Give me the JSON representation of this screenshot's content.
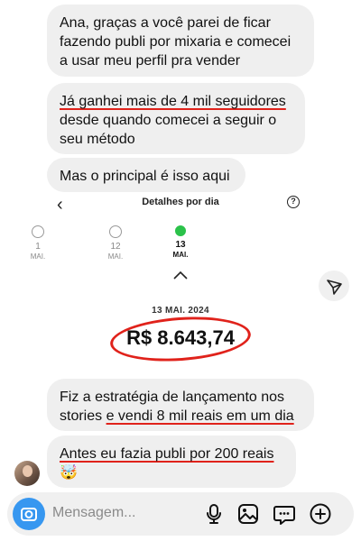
{
  "messages": [
    {
      "lines": [
        "Ana, graças a você parei de ficar",
        "fazendo publi por mixaria e comecei",
        "a usar meu perfil pra vender"
      ]
    },
    {
      "lines": [
        "Já ganhei mais de 4 mil seguidores",
        "desde quando comecei a seguir o",
        "seu método"
      ]
    },
    {
      "lines": [
        "Mas o principal é isso aqui"
      ]
    },
    {
      "line1": "Fiz a estratégia de lançamento nos",
      "line2_a": "stories ",
      "line2_b": "e vendi 8 mil reais em um dia"
    },
    {
      "lines": [
        "Antes eu fazia publi por 200 reais"
      ],
      "emoji": "🤯"
    }
  ],
  "screenshot": {
    "title": "Detalhes por dia",
    "help": "?",
    "days": [
      {
        "num": "1",
        "month": "MAI."
      },
      {
        "num": "12",
        "month": "MAI."
      },
      {
        "num": "13",
        "month": "MAI.",
        "selected": true
      }
    ],
    "date": "13 MAI. 2024",
    "amount": "R$ 8.643,74"
  },
  "composer": {
    "placeholder": "Mensagem..."
  },
  "colors": {
    "bubble": "#efefef",
    "underline": "#e0221b",
    "camera": "#3797f0",
    "selected_day": "#2bc24a"
  }
}
